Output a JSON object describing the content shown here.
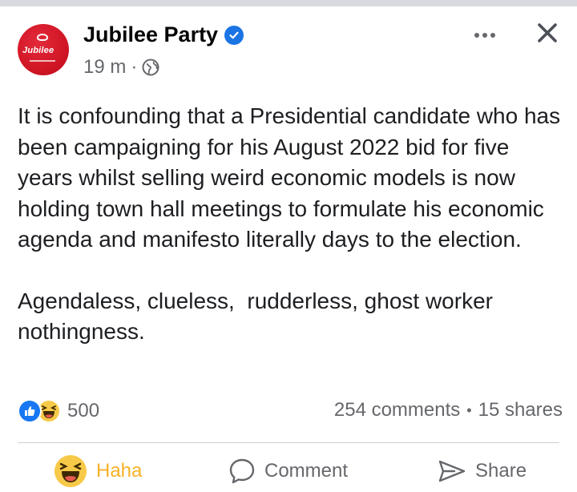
{
  "post": {
    "page_name": "Jubilee Party",
    "avatar_text": "Jubilee",
    "time": "19 m",
    "separator": "·",
    "paragraphs": [
      "It is confounding that a Presidential candidate who has been campaigning for his August 2022 bid for five years whilst selling weird economic models is now holding town hall meetings to formulate his economic agenda and manifesto literally days to the election.",
      "Agendaless, clueless,  rudderless, ghost worker nothingness."
    ]
  },
  "stats": {
    "reaction_count": "500",
    "comments": "254 comments",
    "dot": "•",
    "shares": "15 shares"
  },
  "actions": {
    "haha_label": "Haha",
    "comment_label": "Comment",
    "share_label": "Share"
  },
  "colors": {
    "brand_red": "#d11626",
    "verified_blue": "#1b74e4",
    "like_blue": "#1877f2",
    "haha_yellow": "#f7b125",
    "muted_text": "#65676b"
  },
  "icons": {
    "verified": "verified-badge-icon",
    "globe": "globe-icon",
    "more": "more-dots-icon",
    "close": "close-icon",
    "like": "like-reaction-icon",
    "haha": "haha-reaction-icon",
    "comment": "comment-icon",
    "share": "share-icon"
  }
}
